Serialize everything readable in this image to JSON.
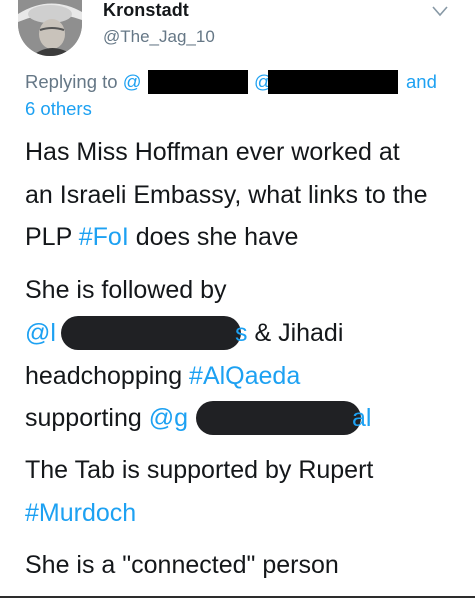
{
  "tweet": {
    "display_name": "Kronstadt",
    "handle": "@The_Jag_10",
    "reply": {
      "prefix": "Replying to",
      "mention_start": "@",
      "mention2_start": "@",
      "and": "and",
      "others": "6 others"
    },
    "body": {
      "line1": "Has Miss Hoffman ever worked at",
      "line2": "an Israeli Embassy, what links to the",
      "line3_text": "PLP ",
      "line3_hashtag": "#FoI",
      "line3_rest": " does she have",
      "line4": "She is followed by",
      "line5_mention": "@l",
      "line5_tail": "s",
      "line5_rest": " & Jihadi",
      "line6_text": "headchopping ",
      "line6_hashtag": "#AlQaeda",
      "line7_text": "supporting ",
      "line7_mention": "@g",
      "line7_tail": "al",
      "line8": "The Tab is supported by Rupert",
      "line9_hashtag": "#Murdoch",
      "line10": "She is a \"connected\" person"
    }
  },
  "colors": {
    "link": "#1da1f2",
    "text": "#14171a",
    "muted": "#657786",
    "redaction": "#000000"
  },
  "icons": {
    "menu": "chevron-down-icon"
  }
}
